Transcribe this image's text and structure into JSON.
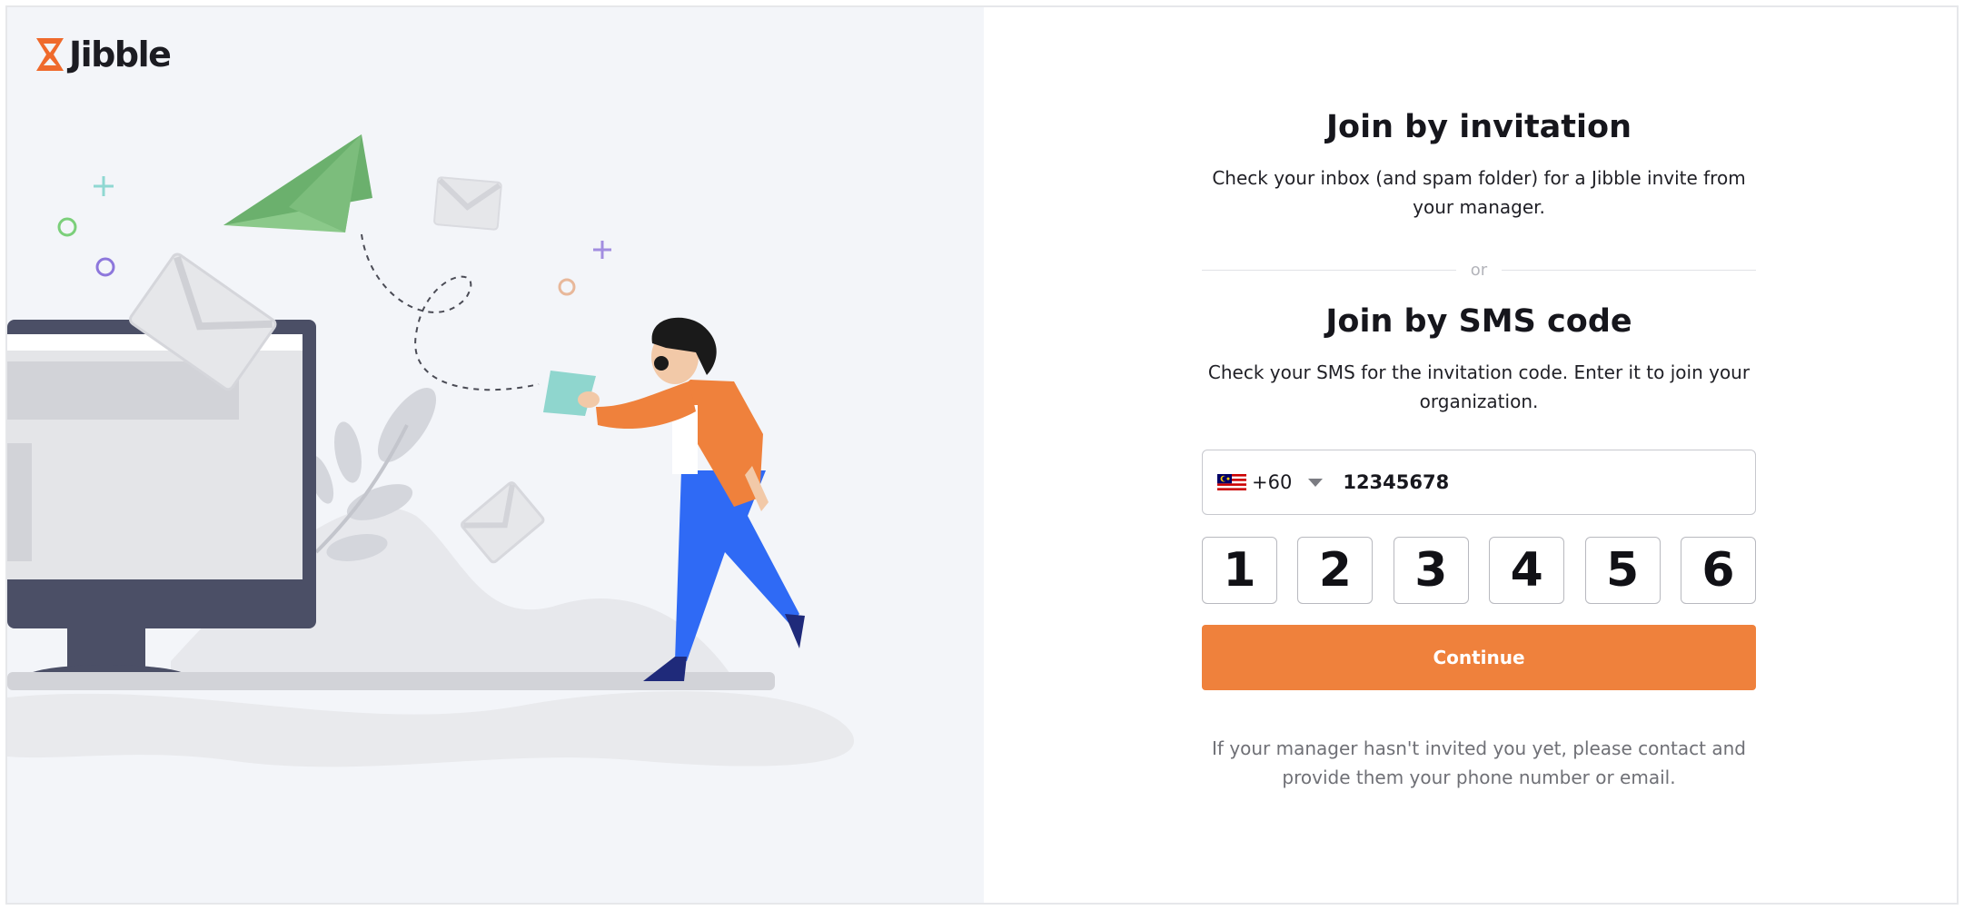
{
  "brand": {
    "name": "Jibble",
    "color": "#ef6a2c"
  },
  "invitation": {
    "title": "Join by invitation",
    "description": "Check your inbox (and spam folder) for a Jibble invite from your manager."
  },
  "divider_text": "or",
  "sms": {
    "title": "Join by SMS code",
    "description": "Check your SMS for the invitation code. Enter it to join your organization."
  },
  "phone": {
    "country_flag": "malaysia-flag-icon",
    "country_code": "+60",
    "number": "12345678"
  },
  "code_digits": [
    "1",
    "2",
    "3",
    "4",
    "5",
    "6"
  ],
  "continue_label": "Continue",
  "footnote": "If your manager hasn't invited you yet, please contact and provide them your phone number or email.",
  "colors": {
    "accent": "#ef813c",
    "panel": "#f3f5f9"
  }
}
